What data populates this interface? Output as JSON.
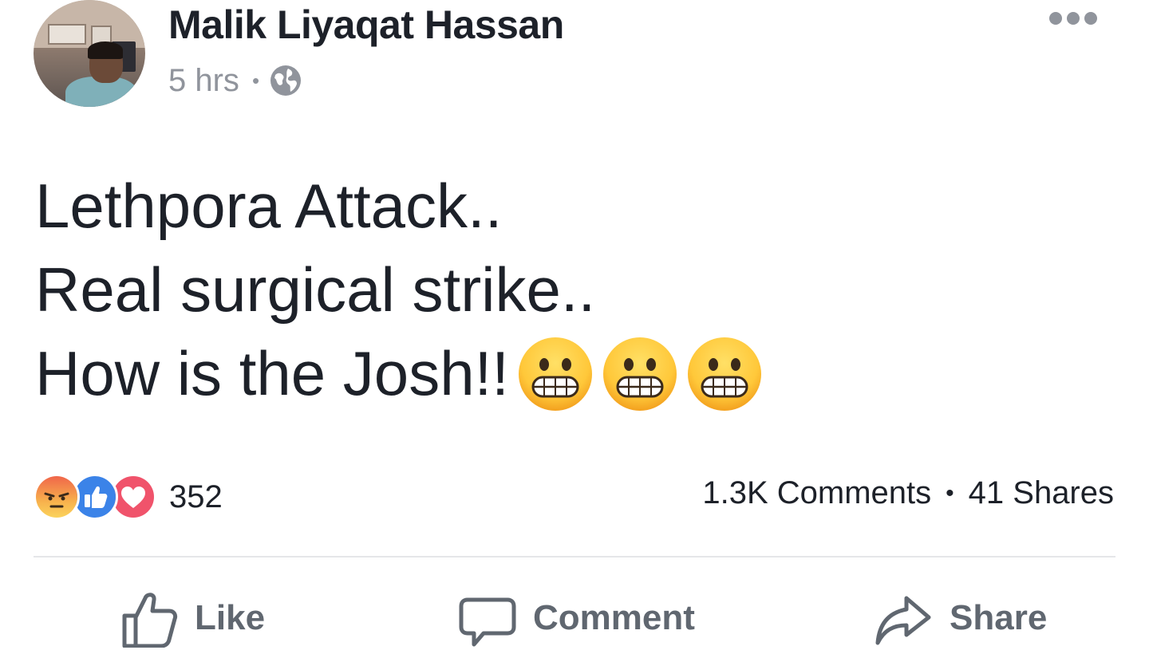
{
  "post": {
    "author": "Malik Liyaqat Hassan",
    "time": "5 hrs",
    "separator": "•",
    "privacy_icon": "globe-icon",
    "more_icon": "more-options-icon",
    "body_lines": [
      "Lethpora Attack..",
      "Real surgical strike..",
      "How is the Josh!!"
    ],
    "emoji": [
      "grinning-face-emoji",
      "grinning-face-emoji",
      "grinning-face-emoji"
    ]
  },
  "reactions": {
    "icons": [
      "angry-reaction-icon",
      "like-reaction-icon",
      "love-reaction-icon"
    ],
    "count": "352",
    "comments": "1.3K Comments",
    "separator": "•",
    "shares": "41 Shares"
  },
  "actions": {
    "like": "Like",
    "comment": "Comment",
    "share": "Share"
  },
  "colors": {
    "text": "#1d2129",
    "meta": "#90949c",
    "action": "#606770",
    "like_blue": "#1877f2",
    "love_red": "#f0536b",
    "angry_orange": "#f4a24a"
  }
}
